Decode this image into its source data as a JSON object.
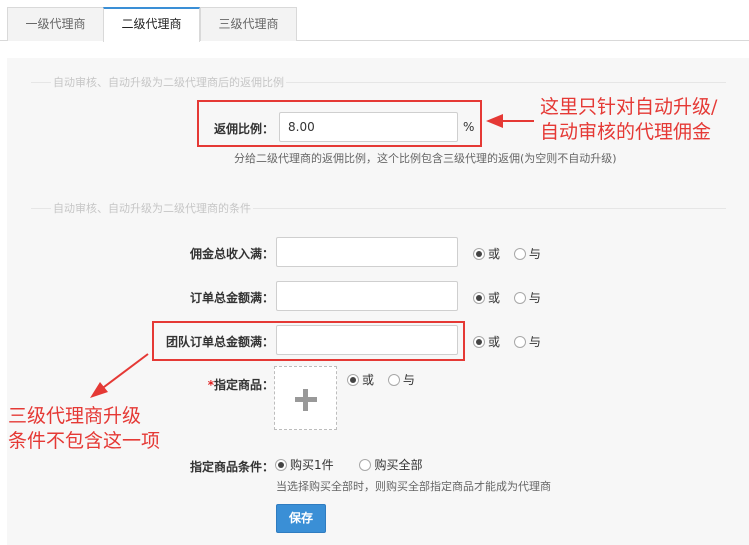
{
  "tabs": [
    {
      "label": "一级代理商"
    },
    {
      "label": "二级代理商"
    },
    {
      "label": "三级代理商"
    }
  ],
  "section1": {
    "legend": "自动审核、自动升级为二级代理商后的返佣比例",
    "rate_label": "返佣比例：",
    "rate_value": "8.00",
    "rate_unit": "%",
    "rate_hint": "分给二级代理商的返佣比例，这个比例包含三级代理的返佣(为空则不自动升级)"
  },
  "section2": {
    "legend": "自动审核、自动升级为二级代理商的条件",
    "conditions": [
      {
        "label": "佣金总收入满：",
        "value": "",
        "opt_or": "或",
        "opt_and": "与"
      },
      {
        "label": "订单总金额满：",
        "value": "",
        "opt_or": "或",
        "opt_and": "与"
      },
      {
        "label": "团队订单总金额满：",
        "value": "",
        "opt_or": "或",
        "opt_and": "与"
      }
    ],
    "product": {
      "required_mark": "*",
      "label": "指定商品：",
      "opt_or": "或",
      "opt_and": "与"
    },
    "product_cond": {
      "label": "指定商品条件：",
      "opt_one": "购买1件",
      "opt_all": "购买全部",
      "hint": "当选择购买全部时，则购买全部指定商品才能成为代理商"
    },
    "save_label": "保存"
  },
  "annotations": {
    "note1_line1": "这里只针对自动升级/",
    "note1_line2": "自动审核的代理佣金",
    "note2_line1": "三级代理商升级",
    "note2_line2": "条件不包含这一项",
    "color": "#e53935"
  },
  "colors": {
    "accent": "#3a8fd6",
    "panel_bg": "#f7f7f7"
  }
}
